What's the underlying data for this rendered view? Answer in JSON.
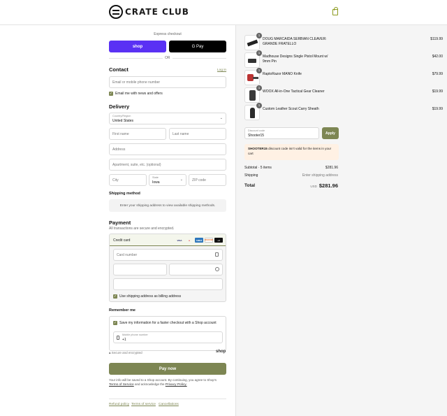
{
  "brand": {
    "name": "CRATE CLUB"
  },
  "express": {
    "title": "Express checkout",
    "shop_label": "shop",
    "gpay_label": "G Pay",
    "or": "OR"
  },
  "contact": {
    "title": "Contact",
    "login": "Log in",
    "email_placeholder": "Email or mobile phone number",
    "news_label": "Email me with news and offers"
  },
  "delivery": {
    "title": "Delivery",
    "country_label": "Country/Region",
    "country_value": "United States",
    "first_placeholder": "First name",
    "last_placeholder": "Last name",
    "address_placeholder": "Address",
    "apt_placeholder": "Apartment, suite, etc. (optional)",
    "city_placeholder": "City",
    "state_label": "State",
    "state_value": "Iowa",
    "zip_placeholder": "ZIP code"
  },
  "shipping": {
    "title": "Shipping method",
    "message": "Enter your shipping address to view available shipping methods."
  },
  "payment": {
    "title": "Payment",
    "subtitle": "All transactions are secure and encrypted.",
    "method": "Credit card",
    "cards": [
      "VISA",
      "MC",
      "AMEX",
      "DISCOVER",
      "+4"
    ],
    "card_number": "Card number",
    "billing_label": "Use shipping address as billing address"
  },
  "remember": {
    "title": "Remember me",
    "save_label": "Save my information for a faster checkout with a Shop account",
    "phone_label": "Mobile phone number",
    "phone_value": "+1",
    "secure": "Secure and encrypted",
    "shop": "shop"
  },
  "pay": {
    "button": "Pay now",
    "terms_1": "Your info will be saved to a Shop account. By continuing, you agree to Shop's",
    "terms_link1": "Terms of Service",
    "terms_2": "and acknowledge the",
    "terms_link2": "Privacy Policy."
  },
  "footer": {
    "links": [
      "Refund policy",
      "Terms of service",
      "Cancellations"
    ]
  },
  "cart": {
    "items": [
      {
        "name": "DOUG MARCAIDA SERBIAN CLEAVER: GRANDE FRATELLO",
        "price": "$119.99",
        "qty": "1"
      },
      {
        "name": "Madhouse Designs Single Pistol Mount w/ 9mm Pin",
        "price": "$42.00",
        "qty": "1"
      },
      {
        "name": "RaptoRazor MANO Knife",
        "price": "$79.99",
        "qty": "1"
      },
      {
        "name": "WOOX All-in-One Tactical Gear Cleaner",
        "price": "$19.99",
        "qty": "1"
      },
      {
        "name": "Custom Leather Scout Carry Sheath",
        "price": "$19.99",
        "qty": "1"
      }
    ],
    "discount_label": "Discount code",
    "discount_value": "Shooter15",
    "apply": "Apply",
    "error_code": "SHOOTER15",
    "error_text": " discount code isn't valid for the items in your cart",
    "subtotal_label": "Subtotal · 5 items",
    "subtotal": "$281.96",
    "shipping_label": "Shipping",
    "shipping_value": "Enter shipping address",
    "total_label": "Total",
    "currency": "USD",
    "total": "$281.96"
  },
  "colors": {
    "accent": "#7d8653",
    "shop": "#5a31f4"
  }
}
